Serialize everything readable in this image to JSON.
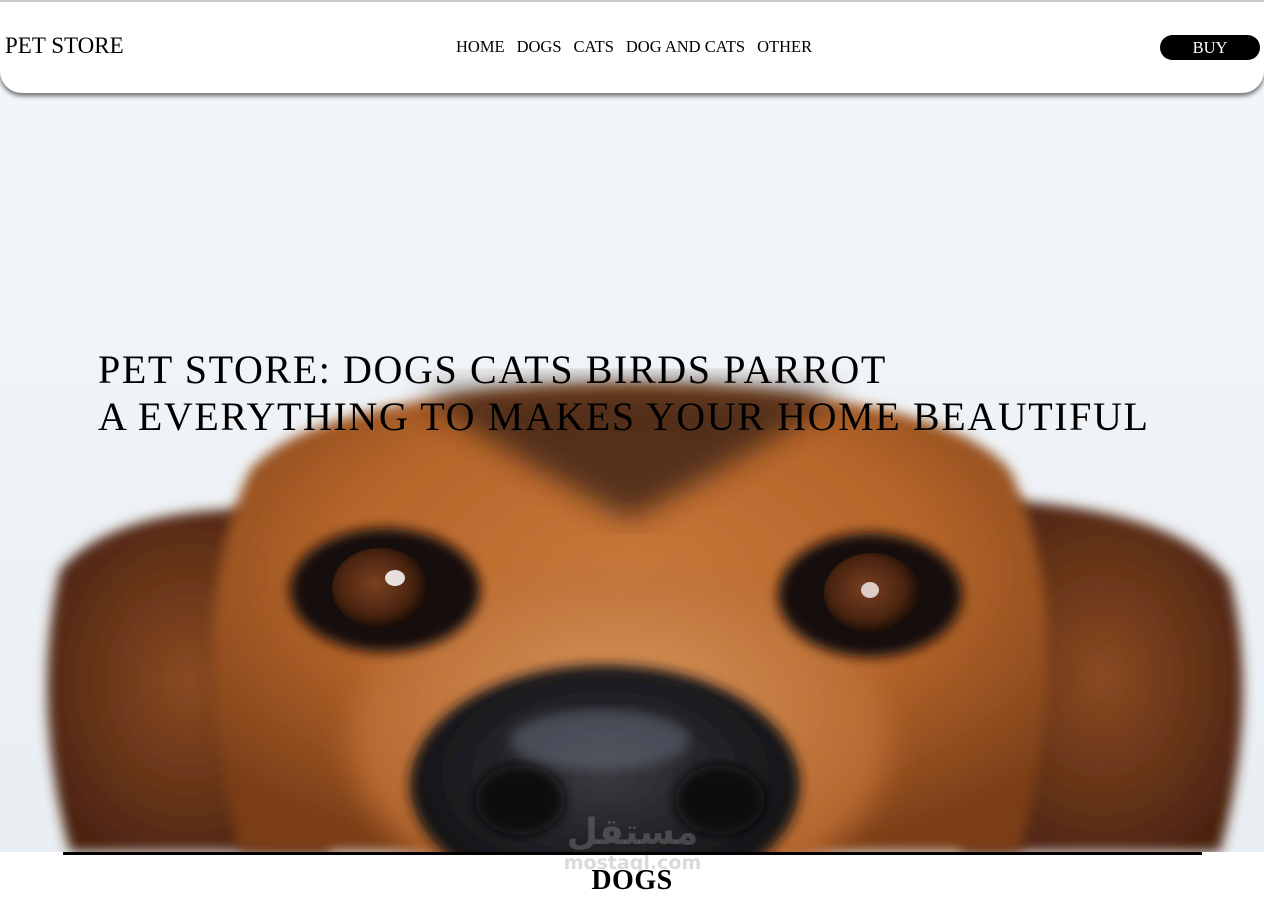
{
  "navbar": {
    "brand": "PET STORE",
    "links": [
      "HOME",
      "DOGS",
      "CATS",
      "DOG AND CATS",
      "OTHER"
    ],
    "buy_label": "BUY"
  },
  "hero": {
    "headline_line1": "PET STORE: DOGS CATS BIRDS PARROT",
    "headline_line2": "A EVERYTHING TO MAKES YOUR HOME BEAUTIFUL",
    "image": "dog-closeup-photo"
  },
  "section": {
    "title": "DOGS"
  },
  "watermark": {
    "arabic": "مستقل",
    "latin": "mostaql.com"
  },
  "colors": {
    "navbar_bg": "#ffffff",
    "button_bg": "#000000",
    "button_text": "#ffffff",
    "text": "#000000",
    "hero_bg": "#f0f4f7",
    "dog_fur": "#b8652a"
  }
}
